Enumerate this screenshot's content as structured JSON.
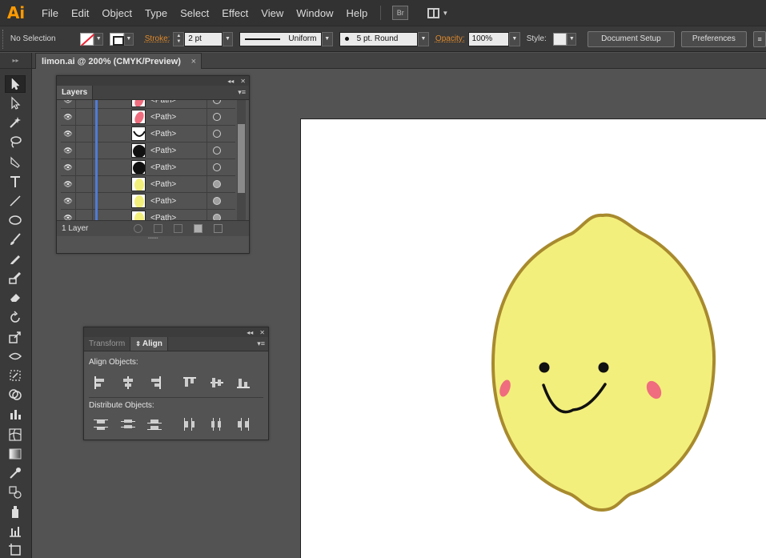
{
  "app": {
    "logo": "Ai"
  },
  "menu": [
    "File",
    "Edit",
    "Object",
    "Type",
    "Select",
    "Effect",
    "View",
    "Window",
    "Help"
  ],
  "bridge_label": "Br",
  "control_bar": {
    "selection": "No Selection",
    "stroke_label": "Stroke:",
    "stroke_weight": "2 pt",
    "profile": "Uniform",
    "brush": "5 pt. Round",
    "opacity_label": "Opacity:",
    "opacity_value": "100%",
    "style_label": "Style:",
    "document_setup": "Document Setup",
    "preferences": "Preferences"
  },
  "document": {
    "tab_title": "limon.ai @ 200% (CMYK/Preview)",
    "close": "×"
  },
  "layers_panel": {
    "tab": "Layers",
    "rows": [
      {
        "name": "<Path>",
        "thumb": "pink-ellipse",
        "target": "open"
      },
      {
        "name": "<Path>",
        "thumb": "pink-ellipse",
        "target": "open"
      },
      {
        "name": "<Path>",
        "thumb": "smile",
        "target": "open"
      },
      {
        "name": "<Path>",
        "thumb": "black-dot",
        "target": "open"
      },
      {
        "name": "<Path>",
        "thumb": "black-dot",
        "target": "open"
      },
      {
        "name": "<Path>",
        "thumb": "yellow-lemon",
        "target": "filled"
      },
      {
        "name": "<Path>",
        "thumb": "yellow-lemon",
        "target": "filled"
      },
      {
        "name": "<Path>",
        "thumb": "yellow-lemon",
        "target": "filled"
      }
    ],
    "footer": "1 Layer"
  },
  "align_panel": {
    "tabs": [
      "Transform",
      "Align"
    ],
    "align_objects_label": "Align Objects:",
    "distribute_objects_label": "Distribute Objects:"
  },
  "colors": {
    "lemon_fill": "#f3ef7c",
    "lemon_stroke": "#a88a2e",
    "blush": "#ef6d7e",
    "accent_orange": "#ff9a00",
    "layer_color": "#4f7bd6"
  }
}
